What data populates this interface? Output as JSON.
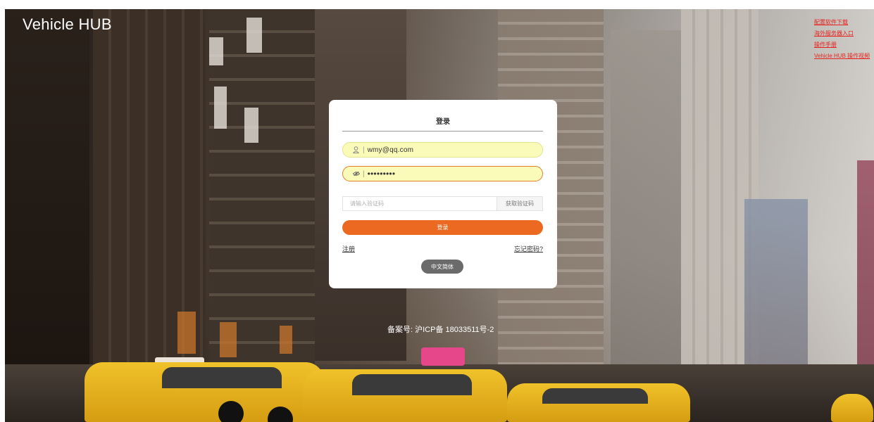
{
  "brand": {
    "title": "Vehicle HUB"
  },
  "top_links": [
    {
      "label": "配置软件下载"
    },
    {
      "label": "海外服务器入口"
    },
    {
      "label": "操作手册"
    },
    {
      "label": "Vehicle HUB 操作视频"
    }
  ],
  "login": {
    "title": "登录",
    "username": {
      "value": "wmy@qq.com",
      "icon": "user-icon"
    },
    "password": {
      "value": "•••••••••",
      "icon": "eye-icon"
    },
    "verification_code": {
      "placeholder": "请输入验证码",
      "button_label": "获取验证码"
    },
    "submit_label": "登录",
    "register_label": "注册",
    "forgot_label": "忘记密码?",
    "language_label": "中文简体"
  },
  "footer": {
    "icp": "备案号: 沪ICP备 18033511号-2"
  },
  "colors": {
    "accent": "#eb6920",
    "link_red": "#e6231d",
    "autofill_yellow": "#fafbb8",
    "lang_button": "#6b6b6b"
  }
}
